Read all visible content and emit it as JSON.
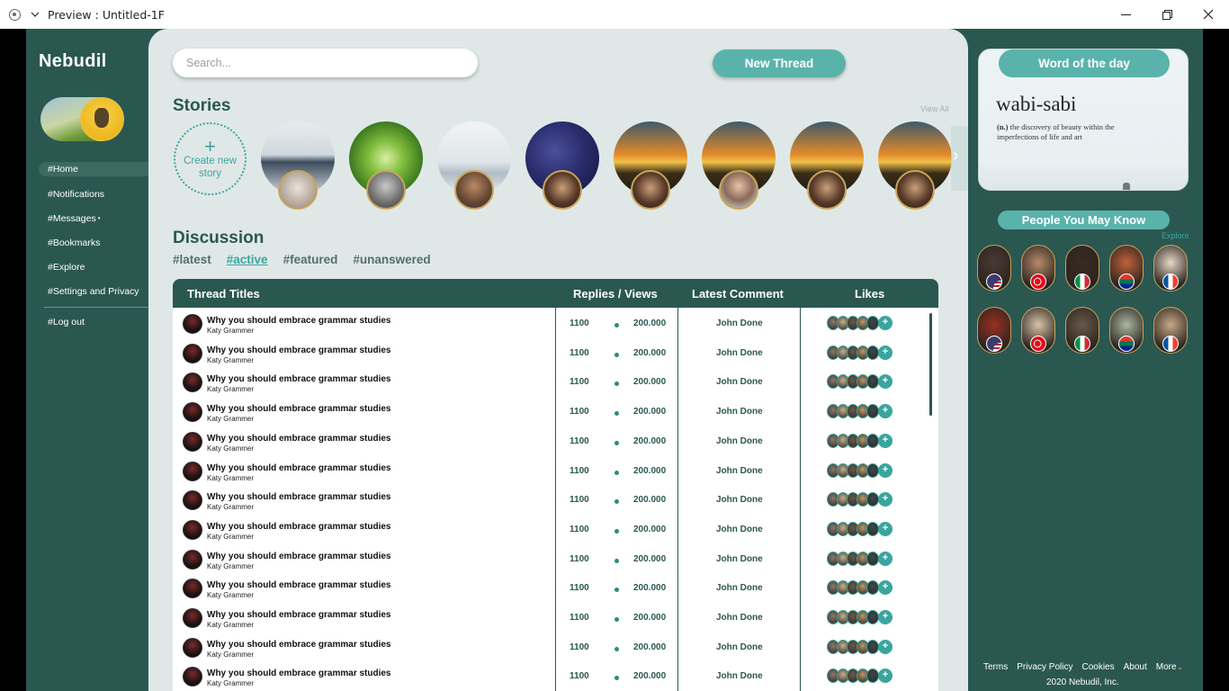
{
  "window": {
    "title": "Preview : Untitled-1F"
  },
  "sidebar": {
    "logo": "Nebudil",
    "nav": [
      {
        "label": "#Home",
        "active": true
      },
      {
        "label": "#Notifications",
        "active": false
      },
      {
        "label": "#Messages",
        "active": false
      },
      {
        "label": "#Bookmarks",
        "active": false
      },
      {
        "label": "#Explore",
        "active": false
      },
      {
        "label": "#Settings and Privacy",
        "active": false
      }
    ],
    "logout": "#Log out"
  },
  "search": {
    "placeholder": "Search..."
  },
  "new_thread": "New Thread",
  "stories": {
    "title": "Stories",
    "view_all": "View All",
    "create_label": "Create new story",
    "count": 8
  },
  "discussion": {
    "title": "Discussion",
    "filters": [
      {
        "label": "#latest",
        "active": false
      },
      {
        "label": "#active",
        "active": true
      },
      {
        "label": "#featured",
        "active": false
      },
      {
        "label": "#unanswered",
        "active": false
      }
    ]
  },
  "table": {
    "headers": {
      "titles": "Thread Titles",
      "replies_views": "Replies / Views",
      "latest_comment": "Latest Comment",
      "likes": "Likes"
    },
    "rows": [
      {
        "title": "Why you should embrace grammar studies",
        "author": "Katy Grammer",
        "replies": "1100",
        "views": "200.000",
        "latest": "John Done"
      },
      {
        "title": "Why you should embrace grammar studies",
        "author": "Katy Grammer",
        "replies": "1100",
        "views": "200.000",
        "latest": "John Done"
      },
      {
        "title": "Why you should embrace grammar studies",
        "author": "Katy Grammer",
        "replies": "1100",
        "views": "200.000",
        "latest": "John Done"
      },
      {
        "title": "Why you should embrace grammar studies",
        "author": "Katy Grammer",
        "replies": "1100",
        "views": "200.000",
        "latest": "John Done"
      },
      {
        "title": "Why you should embrace grammar studies",
        "author": "Katy Grammer",
        "replies": "1100",
        "views": "200.000",
        "latest": "John Done"
      },
      {
        "title": "Why you should embrace grammar studies",
        "author": "Katy Grammer",
        "replies": "1100",
        "views": "200.000",
        "latest": "John Done"
      },
      {
        "title": "Why you should embrace grammar studies",
        "author": "Katy Grammer",
        "replies": "1100",
        "views": "200.000",
        "latest": "John Done"
      },
      {
        "title": "Why you should embrace grammar studies",
        "author": "Katy Grammer",
        "replies": "1100",
        "views": "200.000",
        "latest": "John Done"
      },
      {
        "title": "Why you should embrace grammar studies",
        "author": "Katy Grammer",
        "replies": "1100",
        "views": "200.000",
        "latest": "John Done"
      },
      {
        "title": "Why you should embrace grammar studies",
        "author": "Katy Grammer",
        "replies": "1100",
        "views": "200.000",
        "latest": "John Done"
      },
      {
        "title": "Why you should embrace grammar studies",
        "author": "Katy Grammer",
        "replies": "1100",
        "views": "200.000",
        "latest": "John Done"
      },
      {
        "title": "Why you should embrace grammar studies",
        "author": "Katy Grammer",
        "replies": "1100",
        "views": "200.000",
        "latest": "John Done"
      },
      {
        "title": "Why you should embrace grammar studies",
        "author": "Katy Grammer",
        "replies": "1100",
        "views": "200.000",
        "latest": "John Done"
      }
    ]
  },
  "word_of_day": {
    "label": "Word of the day",
    "word": "wabi-sabi",
    "pos": "(n.)",
    "definition": "the discovery of beauty within the imperfections of life and art"
  },
  "people": {
    "title": "People You May Know",
    "explore": "Explore",
    "flags": [
      "us-flag",
      "turkey-flag",
      "italy-flag",
      "south-africa-flag",
      "france-flag",
      "us-flag",
      "turkey-flag",
      "italy-flag",
      "south-africa-flag",
      "france-flag"
    ]
  },
  "footer": {
    "links": [
      "Terms",
      "Privacy Policy",
      "Cookies",
      "About",
      "More"
    ],
    "copyright": "2020 Nebudil, Inc."
  },
  "colors": {
    "brand_dark": "#2b5751",
    "accent": "#5ab3ab",
    "panel_bg": "#dfe8e7"
  }
}
